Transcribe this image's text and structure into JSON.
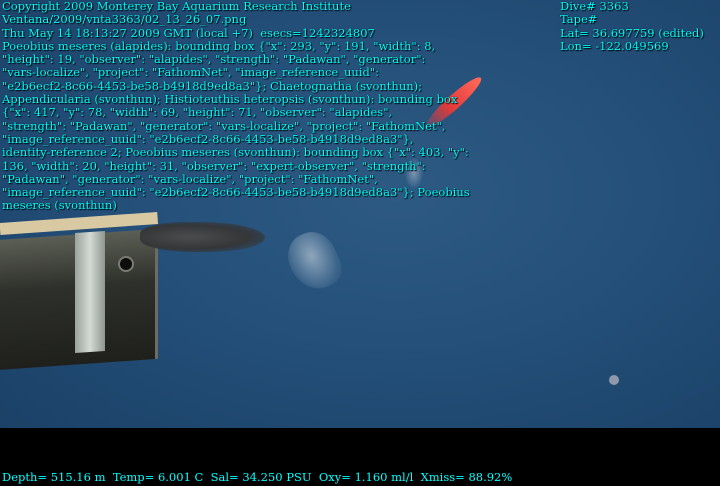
{
  "header": {
    "lines": [
      "Copyright 2009 Monterey Bay Aquarium Research Institute",
      "Ventana/2009/vnta3363/02_13_26_07.png",
      "Thu May 14 18:13:27 2009 GMT (local +7)  esecs=1242324807",
      "Poeobius meseres (alapides): bounding box {\"x\": 293, \"y\": 191, \"width\": 8,",
      "\"height\": 19, \"observer\": \"alapides\", \"strength\": \"Padawan\", \"generator\":",
      "\"vars-localize\", \"project\": \"FathomNet\", \"image_reference_uuid\":",
      "\"e2b6ecf2-8c66-4453-be58-b4918d9ed8a3\"}; Chaetognatha (svonthun);",
      "Appendicularia (svonthun); Histioteuthis heteropsis (svonthun): bounding box",
      "{\"x\": 417, \"y\": 78, \"width\": 69, \"height\": 71, \"observer\": \"alapides\",",
      "\"strength\": \"Padawan\", \"generator\": \"vars-localize\", \"project\": \"FathomNet\",",
      "\"image_reference_uuid\": \"e2b6ecf2-8c66-4453-be58-b4918d9ed8a3\"},",
      "identity-reference 2; Poeobius meseres (svonthun): bounding box {\"x\": 403, \"y\":",
      "136, \"width\": 20, \"height\": 31, \"observer\": \"expert-observer\", \"strength\":",
      "\"Padawan\", \"generator\": \"vars-localize\", \"project\": \"FathomNet\",",
      "\"image_reference_uuid\": \"e2b6ecf2-8c66-4453-be58-b4918d9ed8a3\"}; Poeobius",
      "meseres (svonthun)"
    ]
  },
  "dive_info": {
    "dive": "Dive# 3363",
    "tape": "Tape#",
    "lat": "Lat= 36.697759 (edited)",
    "lon": "Lon= -122.049569"
  },
  "telemetry": "Depth= 515.16 m  Temp= 6.001 C  Sal= 34.250 PSU  Oxy= 1.160 ml/l  Xmiss= 88.92%",
  "colors": {
    "overlay_text": "#00ffff",
    "water": "#24507a"
  }
}
